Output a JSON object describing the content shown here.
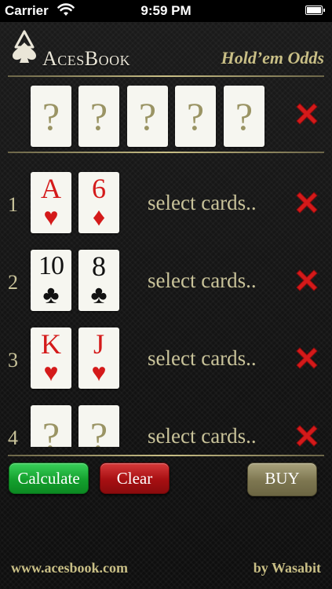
{
  "status_bar": {
    "carrier": "Carrier",
    "time": "9:59 PM"
  },
  "header": {
    "logo_text": "AcesBook",
    "title": "Hold’em Odds"
  },
  "board": {
    "cards": [
      "?",
      "?",
      "?",
      "?",
      "?"
    ]
  },
  "players": [
    {
      "number": "1",
      "label": "select cards..",
      "cards": [
        {
          "rank": "A",
          "suit": "♥",
          "color": "red"
        },
        {
          "rank": "6",
          "suit": "♦",
          "color": "red"
        }
      ]
    },
    {
      "number": "2",
      "label": "select cards..",
      "cards": [
        {
          "rank": "10",
          "suit": "♣",
          "color": "black"
        },
        {
          "rank": "8",
          "suit": "♣",
          "color": "black"
        }
      ]
    },
    {
      "number": "3",
      "label": "select cards..",
      "cards": [
        {
          "rank": "K",
          "suit": "♥",
          "color": "red"
        },
        {
          "rank": "J",
          "suit": "♥",
          "color": "red"
        }
      ]
    },
    {
      "number": "4",
      "label": "select cards..",
      "cards": [
        {
          "rank": "?",
          "suit": "",
          "color": "unknown"
        },
        {
          "rank": "?",
          "suit": "",
          "color": "unknown"
        }
      ]
    }
  ],
  "buttons": {
    "calculate": "Calculate",
    "clear": "Clear",
    "buy": "BUY"
  },
  "footer": {
    "website": "www.acesbook.com",
    "credit": "by Wasabit"
  },
  "colors": {
    "accent_gold": "#c9bf86",
    "delete_red": "#d41a1a",
    "calculate_green": "#14a02e",
    "clear_red": "#a70f12",
    "buy_olive": "#7d7650"
  }
}
